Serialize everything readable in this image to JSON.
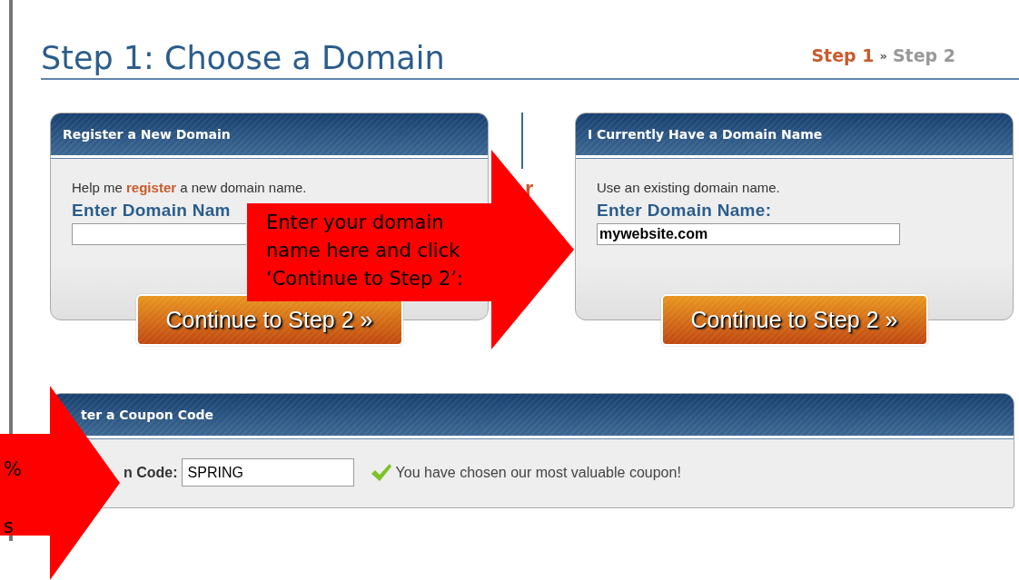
{
  "page": {
    "title": "Step 1: Choose a Domain",
    "steps": [
      {
        "label": "Step 1",
        "selected": true
      },
      {
        "label": "Step 2",
        "selected": false
      }
    ],
    "step_separator": "»"
  },
  "panels": [
    {
      "title": "Register a New Domain",
      "intro": "Help me **register** a new domain name.",
      "field_label": "Enter Domain Nam",
      "button": "Continue to Step 2 »"
    },
    {
      "title": "I Currently Have a Domain Name",
      "intro": "Use an existing domain name.",
      "field_label": "Enter Domain Name:",
      "value": "mywebsite.com",
      "button": "Continue to Step 2 »"
    }
  ],
  "divider_text": "r",
  "coupon": {
    "title": "ter a Coupon Code",
    "label": "n Code:",
    "value": "SPRING",
    "message": "You have chosen our most valuable coupon!"
  },
  "callouts": [
    {
      "lines": [
        "Enter your domain",
        "name here and click",
        "‘Continue to Step 2’:"
      ]
    },
    {
      "lines": [
        "%",
        "s"
      ]
    }
  ]
}
